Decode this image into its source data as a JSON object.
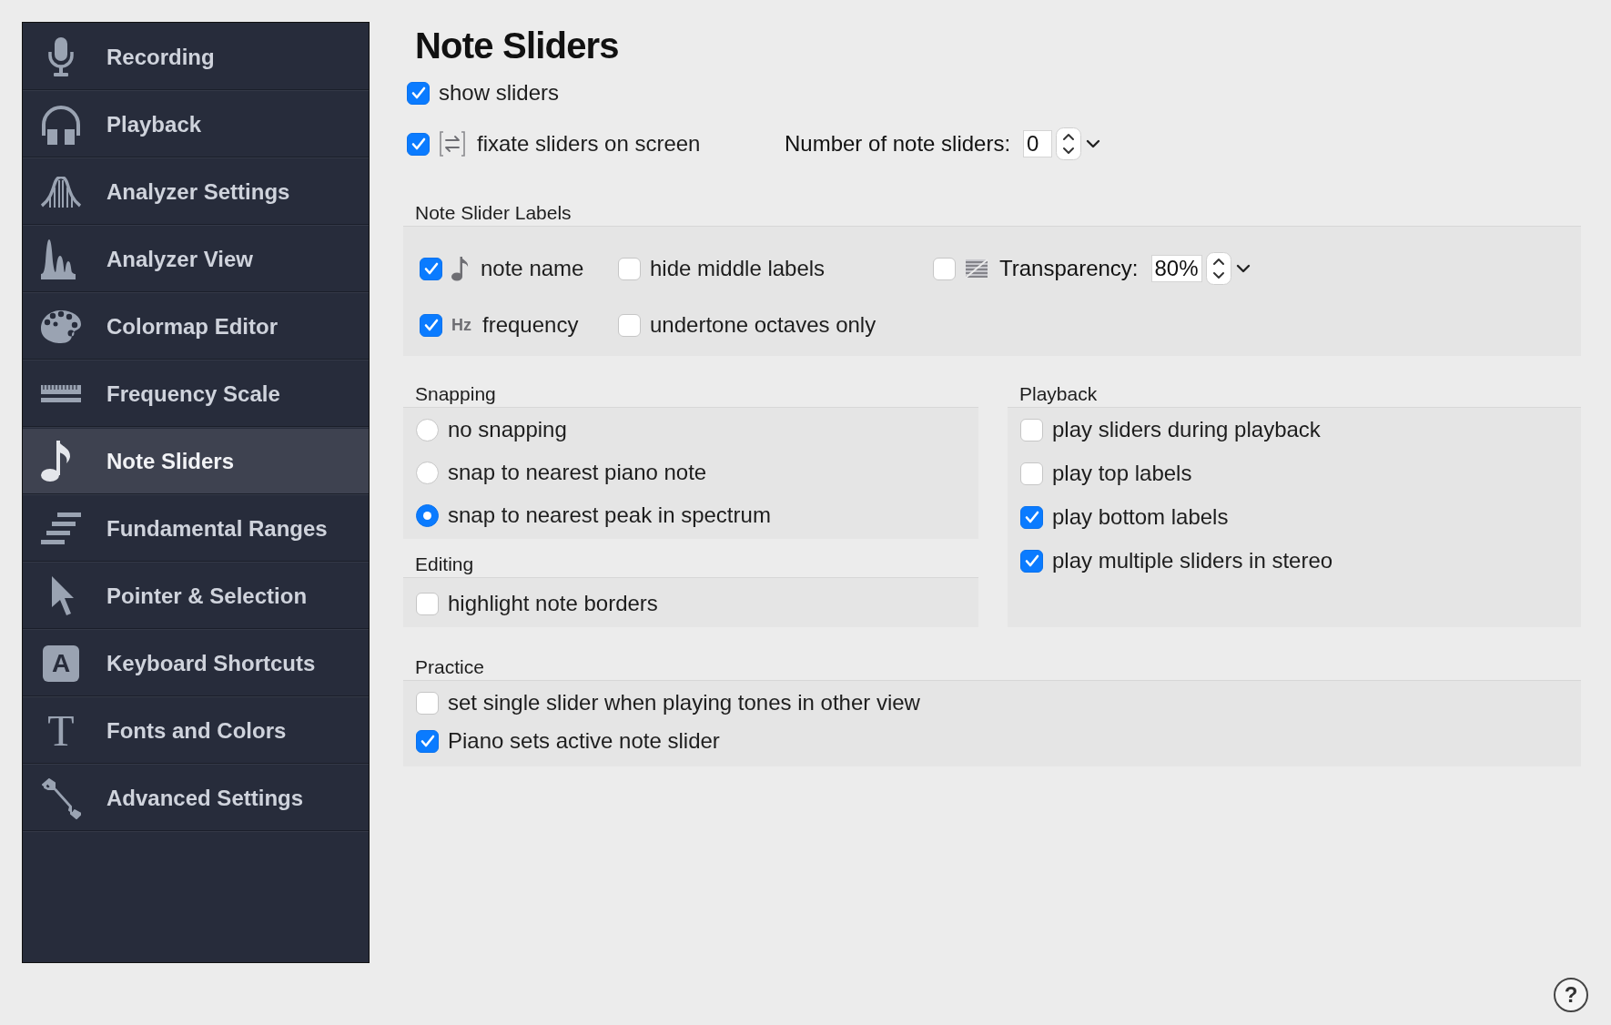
{
  "sidebar": {
    "items": [
      {
        "label": "Recording",
        "selected": false
      },
      {
        "label": "Playback",
        "selected": false
      },
      {
        "label": "Analyzer Settings",
        "selected": false
      },
      {
        "label": "Analyzer View",
        "selected": false
      },
      {
        "label": "Colormap Editor",
        "selected": false
      },
      {
        "label": "Frequency Scale",
        "selected": false
      },
      {
        "label": "Note Sliders",
        "selected": true
      },
      {
        "label": "Fundamental Ranges",
        "selected": false
      },
      {
        "label": "Pointer & Selection",
        "selected": false
      },
      {
        "label": "Keyboard Shortcuts",
        "icon_text": "A",
        "selected": false
      },
      {
        "label": "Fonts and Colors",
        "icon_text": "T",
        "selected": false
      },
      {
        "label": "Advanced Settings",
        "selected": false
      }
    ]
  },
  "page": {
    "title": "Note Sliders",
    "options": [
      {
        "label": "show sliders",
        "checked": true
      },
      {
        "label": "fixate sliders on screen",
        "checked": true
      }
    ],
    "slider_count": {
      "label": "Number of note sliders:",
      "value": "0"
    }
  },
  "note_slider_labels": {
    "title": "Note Slider Labels",
    "options": [
      {
        "label": "note name",
        "checked": true
      },
      {
        "label": "hide middle labels",
        "checked": false
      },
      {
        "label": "frequency",
        "icon_text": "Hz",
        "checked": true
      },
      {
        "label": "undertone octaves only",
        "checked": false
      }
    ],
    "transparency": {
      "checked": false,
      "label": "Transparency:",
      "value": "80%"
    }
  },
  "snapping": {
    "title": "Snapping",
    "options": [
      {
        "label": "no snapping",
        "selected": false
      },
      {
        "label": "snap to nearest piano note",
        "selected": false
      },
      {
        "label": "snap to nearest peak in spectrum",
        "selected": true
      }
    ]
  },
  "editing": {
    "title": "Editing",
    "options": [
      {
        "label": "highlight note borders",
        "checked": false
      }
    ]
  },
  "playback": {
    "title": "Playback",
    "options": [
      {
        "label": "play sliders during playback",
        "checked": false
      },
      {
        "label": "play top labels",
        "checked": false
      },
      {
        "label": "play bottom labels",
        "checked": true
      },
      {
        "label": "play multiple sliders in stereo",
        "checked": true
      }
    ]
  },
  "practice": {
    "title": "Practice",
    "options": [
      {
        "label": "set single slider when playing tones in other view",
        "checked": false
      },
      {
        "label": "Piano sets active note slider",
        "checked": true
      }
    ]
  },
  "help_button": "?"
}
